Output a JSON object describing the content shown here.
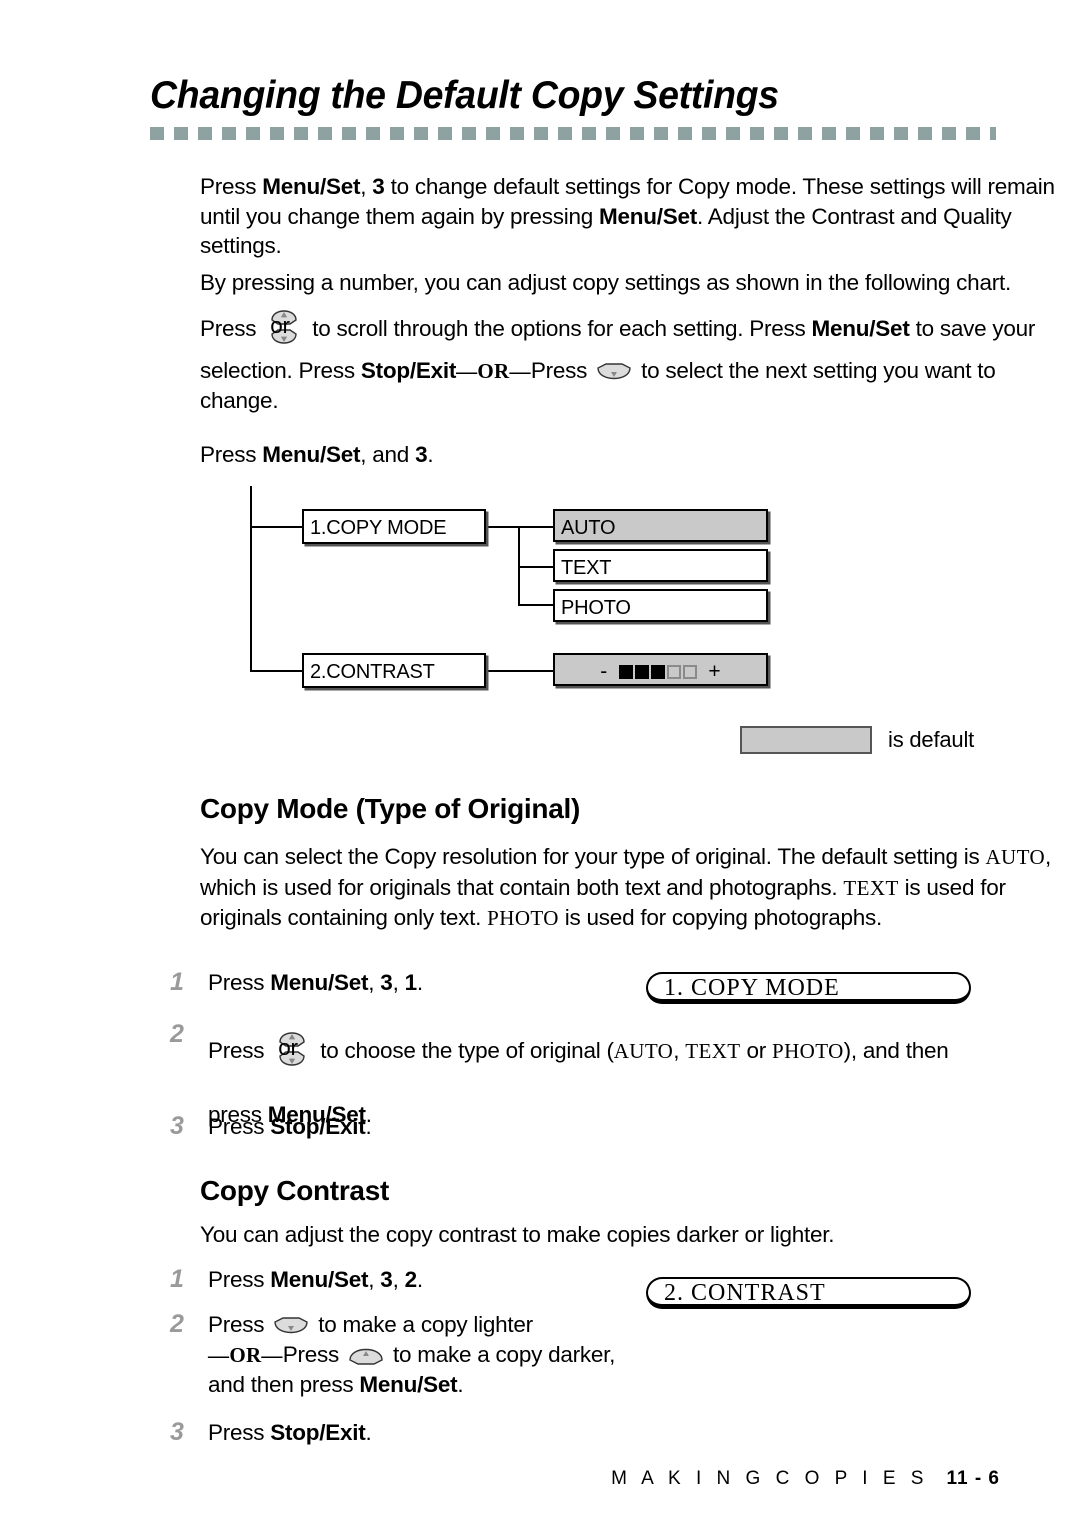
{
  "page": {
    "title": "Changing the Default Copy Settings",
    "footer_title": "M A K I N G   C O P I E S",
    "footer_page": "11 - 6"
  },
  "intro": {
    "p1_a": "Press ",
    "p1_b1": "Menu/Set",
    "p1_c": ", ",
    "p1_b2": "3",
    "p1_d": " to change default settings for Copy mode. These settings will remain until you change them again by pressing ",
    "p1_b3": "Menu/Set",
    "p1_e": ". Adjust the Contrast and Quality settings.",
    "p2_a": "By pressing a number, you can adjust copy settings as shown in the following chart. Press ",
    "p2_or": "or",
    "p2_b": " to scroll through the options for each setting. Press ",
    "p2_b1": "Menu/Set",
    "p2_c": " to save your selection. Press ",
    "p2_b2": "Stop/Exit",
    "p2_or2": "OR",
    "p2_d": "Press ",
    "p2_e": " to select the next setting you want to change.",
    "p3_a": "Press ",
    "p3_b1": "Menu/Set",
    "p3_c": ", and ",
    "p3_b2": "3",
    "p3_d": "."
  },
  "tree": {
    "nodes": [
      {
        "label": "1.COPY MODE",
        "shaded": false
      },
      {
        "label": "2.CONTRAST",
        "shaded": false
      }
    ],
    "copy_mode_options": [
      {
        "label": "AUTO",
        "shaded": true
      },
      {
        "label": "TEXT",
        "shaded": false
      },
      {
        "label": "PHOTO",
        "shaded": false
      }
    ],
    "contrast_gauge": {
      "minus": "-",
      "plus": "+",
      "filled": 3,
      "empty": 2,
      "shaded": true
    }
  },
  "legend": {
    "label": "is default",
    "swatch_color": "#c9c9c9"
  },
  "copy_mode": {
    "heading": "Copy Mode (Type of Original)",
    "desc_a": "You can select the Copy resolution for your type of original. The default setting is ",
    "desc_auto": "AUTO",
    "desc_b": ", which is used for originals that contain both text and photographs. ",
    "desc_text": "TEXT",
    "desc_c": " is used for originals containing only text. ",
    "desc_photo": "PHOTO",
    "desc_d": " is used for copying photographs.",
    "steps": [
      {
        "num": "1",
        "a": "Press ",
        "b1": "Menu/Set",
        "c": ", ",
        "b2": "3",
        "d": ", ",
        "b3": "1",
        "e": "."
      },
      {
        "num": "2",
        "a": "Press ",
        "or": "or",
        "b": " to choose the type of original (",
        "opt1": "AUTO",
        "sep1": ", ",
        "opt2": "TEXT",
        "sep2": " or ",
        "opt3": "PHOTO",
        "c": "), and then",
        "cont_a": "press ",
        "cont_b": "Menu/Set",
        "cont_c": "."
      },
      {
        "num": "3",
        "a": "Press ",
        "b1": "Stop/Exit",
        "c": "."
      }
    ],
    "lcd": "1. COPY  MODE"
  },
  "copy_contrast": {
    "heading": "Copy Contrast",
    "desc": "You can adjust the copy contrast to make copies darker or lighter.",
    "steps": [
      {
        "num": "1",
        "a": "Press ",
        "b1": "Menu/Set",
        "c": ", ",
        "b2": "3",
        "d": ", ",
        "b3": "2",
        "e": "."
      },
      {
        "num": "2",
        "a": "Press ",
        "b": " to make a copy lighter",
        "or": "OR",
        "c_a": "Press ",
        "c_b": " to make a copy darker,",
        "cont_a": "and then press ",
        "cont_b": "Menu/Set",
        "cont_c": "."
      },
      {
        "num": "3",
        "a": "Press ",
        "b1": "Stop/Exit",
        "c": "."
      }
    ],
    "lcd": "2. CONTRAST"
  }
}
